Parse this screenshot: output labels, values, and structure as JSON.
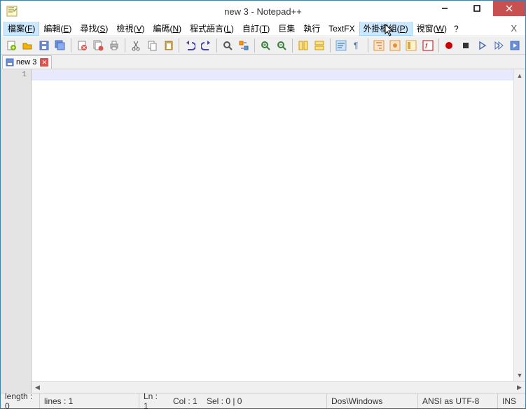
{
  "window": {
    "title": "new  3 - Notepad++"
  },
  "menubar": {
    "items": [
      {
        "label": "檔案",
        "u": "F"
      },
      {
        "label": "編輯",
        "u": "E"
      },
      {
        "label": "尋找",
        "u": "S"
      },
      {
        "label": "檢視",
        "u": "V"
      },
      {
        "label": "編碼",
        "u": "N"
      },
      {
        "label": "程式語言",
        "u": "L"
      },
      {
        "label": "自訂",
        "u": "T"
      },
      {
        "label": "巨集",
        "u": ""
      },
      {
        "label": "執行",
        "u": ""
      },
      {
        "label": "TextFX",
        "u": ""
      },
      {
        "label": "外掛模組",
        "u": "P"
      },
      {
        "label": "視窗",
        "u": "W"
      }
    ],
    "help": "?",
    "closex": "X"
  },
  "tabs": {
    "active": {
      "label": "new  3"
    }
  },
  "editor": {
    "linenumber": "1"
  },
  "statusbar": {
    "length": "length : 0",
    "lines": "lines : 1",
    "ln": "Ln : 1",
    "col": "Col : 1",
    "sel": "Sel : 0 | 0",
    "eol": "Dos\\Windows",
    "encoding": "ANSI as UTF-8",
    "mode": "INS"
  }
}
